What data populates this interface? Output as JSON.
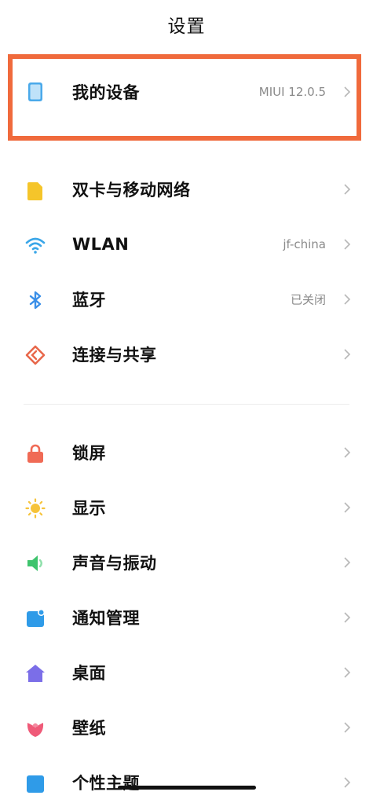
{
  "header": {
    "title": "设置"
  },
  "my_device": {
    "label": "我的设备",
    "value": "MIUI 12.0.5",
    "icon": "phone-icon"
  },
  "network_section": [
    {
      "id": "sim",
      "label": "双卡与移动网络",
      "value": "",
      "icon": "sim-card-icon",
      "color": "#f5c52a"
    },
    {
      "id": "wlan",
      "label": "WLAN",
      "value": "jf-china",
      "icon": "wifi-icon",
      "color": "#3aa6e8"
    },
    {
      "id": "bluetooth",
      "label": "蓝牙",
      "value": "已关闭",
      "icon": "bluetooth-icon",
      "color": "#3a8fe8"
    },
    {
      "id": "share",
      "label": "连接与共享",
      "value": "",
      "icon": "connection-share-icon",
      "color": "#e8674a"
    }
  ],
  "personal_section": [
    {
      "id": "lock",
      "label": "锁屏",
      "icon": "lock-icon",
      "color": "#f06a55"
    },
    {
      "id": "display",
      "label": "显示",
      "icon": "sun-icon",
      "color": "#f6c33a"
    },
    {
      "id": "sound",
      "label": "声音与振动",
      "icon": "speaker-icon",
      "color": "#3ec46d"
    },
    {
      "id": "notify",
      "label": "通知管理",
      "icon": "notification-icon",
      "color": "#2f9be8"
    },
    {
      "id": "desktop",
      "label": "桌面",
      "icon": "home-icon",
      "color": "#7b6ee8"
    },
    {
      "id": "wallpaper",
      "label": "壁纸",
      "icon": "flower-icon",
      "color": "#ef5a78"
    },
    {
      "id": "theme",
      "label": "个性主题",
      "icon": "theme-icon",
      "color": "#2f9be8"
    }
  ]
}
